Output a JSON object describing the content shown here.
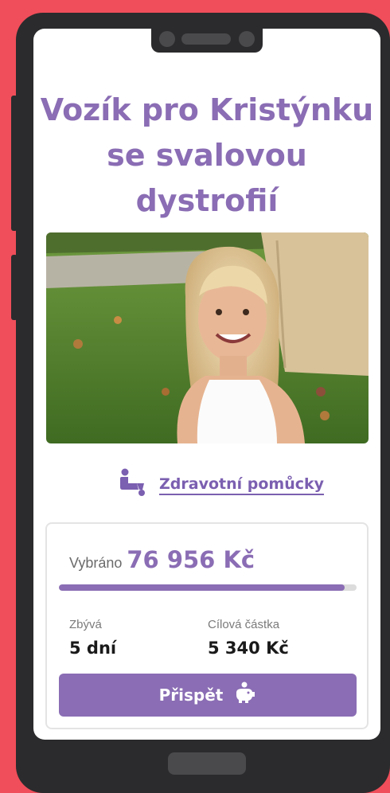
{
  "colors": {
    "accent": "#8a6db4",
    "background": "#f04e5a",
    "phone": "#2b2b2d"
  },
  "campaign": {
    "title_lines": [
      "Vozík pro Kristýnku",
      "se svalovou",
      "dystrofií"
    ],
    "photo": "girl-smiling-photo",
    "category": {
      "icon": "wheelchair-icon",
      "label": "Zdravotní pomůcky"
    }
  },
  "stats": {
    "raised_label": "Vybráno",
    "raised_value": "76 956 Kč",
    "progress": 0.96,
    "remaining_label": "Zbývá",
    "remaining_value": "5 dní",
    "goal_label": "Cílová částka",
    "goal_value": "5 340 Kč"
  },
  "cta": {
    "label": "Přispět",
    "icon": "piggy-bank-icon"
  }
}
